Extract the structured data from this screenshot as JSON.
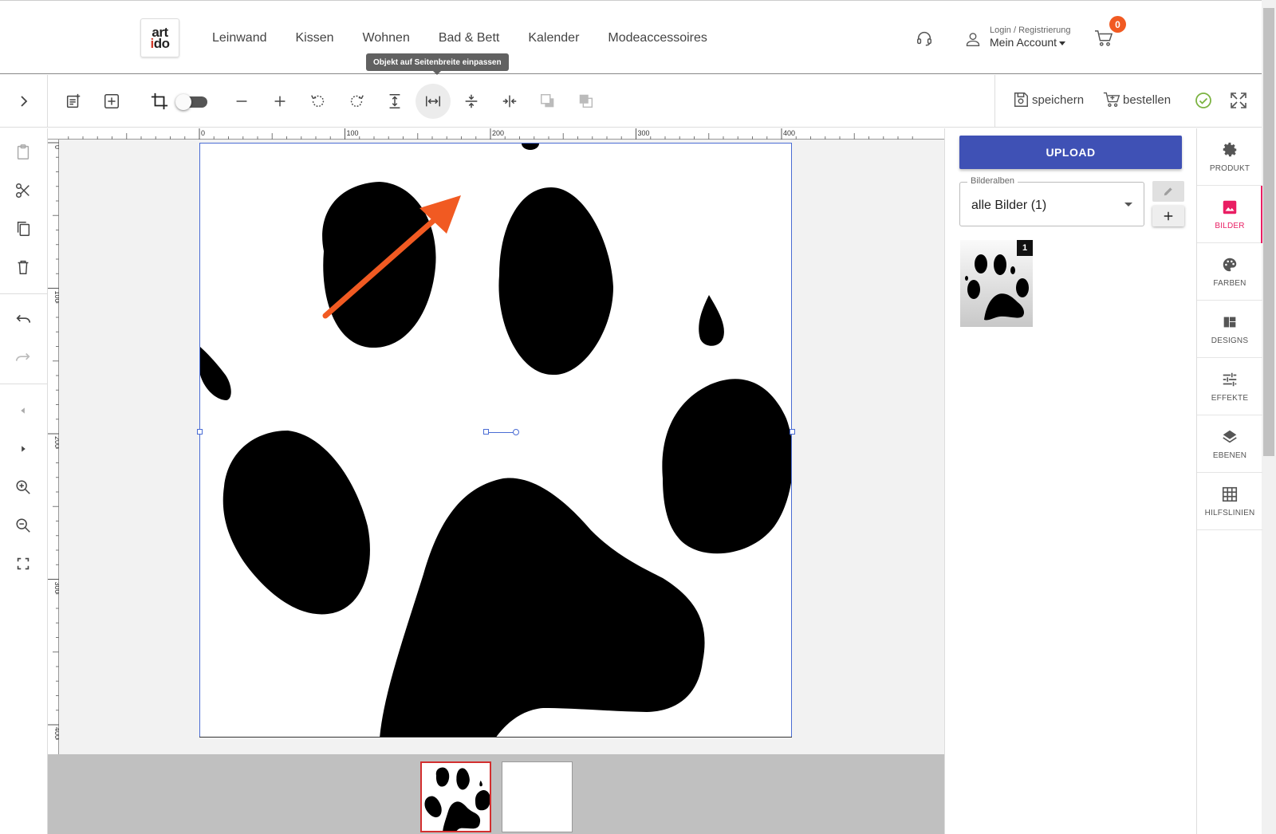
{
  "header": {
    "logo": {
      "line1": "art",
      "line2_accent": "i",
      "line2_rest": "do"
    },
    "nav": [
      "Leinwand",
      "Kissen",
      "Wohnen",
      "Bad & Bett",
      "Kalender",
      "Modeaccessoires"
    ],
    "account": {
      "login_label": "Login / Registrierung",
      "account_label": "Mein Account"
    },
    "cart_count": "0"
  },
  "tooltip": "Objekt auf Seitenbreite einpassen",
  "toolbar": {
    "save_label": "speichern",
    "order_label": "bestellen"
  },
  "ruler": {
    "top_labels": [
      "0",
      "100",
      "200",
      "300",
      "400"
    ],
    "left_labels": [
      "0",
      "100",
      "200",
      "300",
      "400"
    ]
  },
  "right_panel": {
    "upload_label": "UPLOAD",
    "album_legend": "Bilderalben",
    "album_value": "alle Bilder (1)",
    "image_badge": "1"
  },
  "tabs": [
    {
      "label": "PRODUKT",
      "icon": "gear-icon"
    },
    {
      "label": "BILDER",
      "icon": "image-icon",
      "active": true
    },
    {
      "label": "FARBEN",
      "icon": "palette-icon"
    },
    {
      "label": "DESIGNS",
      "icon": "designs-icon"
    },
    {
      "label": "EFFEKTE",
      "icon": "sliders-icon"
    },
    {
      "label": "EBENEN",
      "icon": "layers-icon"
    },
    {
      "label": "HILFSLINIEN",
      "icon": "grid-icon"
    }
  ],
  "colors": {
    "accent": "#3f51b5",
    "active_tab": "#e91e63",
    "badge": "#f15a22",
    "selection": "#4a6cd4",
    "arrow": "#f15a22"
  }
}
